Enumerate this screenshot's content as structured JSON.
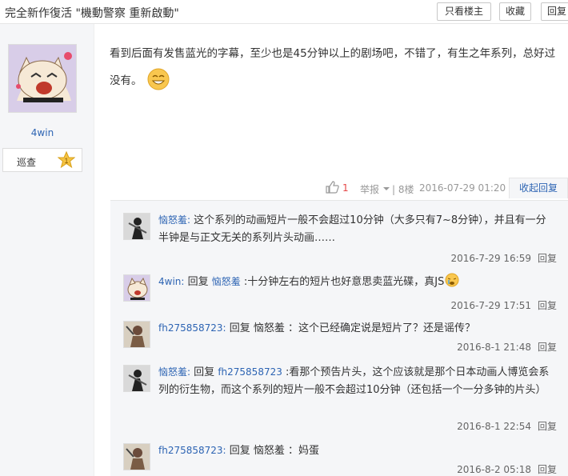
{
  "header": {
    "title": "完全新作復活 \"機動警察 重新啟動\"",
    "only_author_label": "只看楼主",
    "favorite_label": "收藏",
    "reply_label": "回复"
  },
  "author": {
    "name": "4win",
    "level_name": "巡查",
    "level_number": "1"
  },
  "post": {
    "content": "看到后面有发售蓝光的字幕，至少也是45分钟以上的剧场吧，不错了，有生之年系列，总好过没有。",
    "like_count": "1",
    "report_label": "举报",
    "floor": "| 8楼",
    "time": "2016-07-29 01:20",
    "collapse_label": "收起回复"
  },
  "replies": [
    {
      "user": "恼怒羞:",
      "text": " 这个系列的动画短片一般不会超过10分钟（大多只有7~8分钟），并且有一分半钟是与正文无关的系列片头动画……",
      "time": "2016-7-29 16:59",
      "reply_label": "回复",
      "avatar": "ninja-avatar"
    },
    {
      "user": "4win:",
      "prefix": " 回复 ",
      "target": "恼怒羞",
      "text": " :十分钟左右的短片也好意思卖蓝光碟，真JS",
      "time": "2016-7-29 17:51",
      "reply_label": "回复",
      "avatar": "cat-avatar"
    },
    {
      "user": "fh275858723:",
      "text": " 回复 恼怒羞 ：这个已经确定说是短片了？还是谣传？",
      "time": "2016-8-1 21:48",
      "reply_label": "回复",
      "avatar": "warrior-avatar"
    },
    {
      "user": "恼怒羞:",
      "prefix": " 回复 ",
      "target": "fh275858723",
      "text": " :看那个预告片头，这个应该就是那个日本动画人博览会系列的衍生物，而这个系列的短片一般不会超过10分钟（还包括一个一分多钟的片头）",
      "time": "2016-8-1 22:54",
      "reply_label": "回复",
      "avatar": "ninja-avatar"
    },
    {
      "user": "fh275858723:",
      "text": " 回复 恼怒羞 ：妈蛋",
      "time": "2016-8-2 05:18",
      "reply_label": "回复",
      "avatar": "warrior-avatar"
    }
  ],
  "colors": {
    "link": "#2d64b3",
    "like": "#e54646",
    "panel_bg": "#f5f6f8"
  }
}
